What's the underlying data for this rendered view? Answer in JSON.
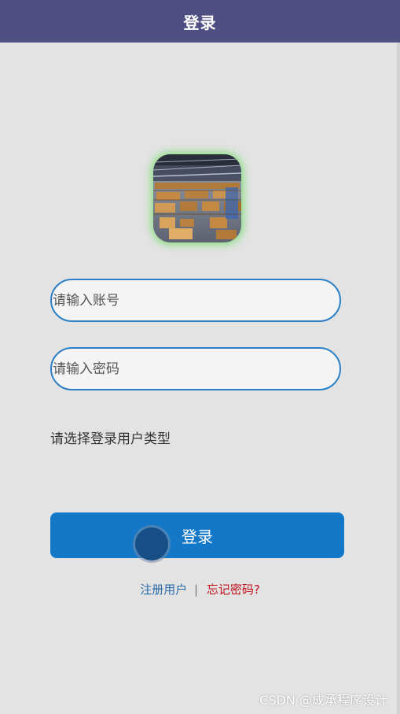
{
  "header": {
    "title": "登录"
  },
  "logo": {
    "description_icon": "warehouse-photo"
  },
  "form": {
    "account_placeholder": "请输入账号",
    "password_placeholder": "请输入密码",
    "user_type_label": "请选择登录用户类型",
    "login_button_label": "登录"
  },
  "links": {
    "register_label": "注册用户",
    "separator": "|",
    "forgot_label": "忘记密码?"
  },
  "watermark": {
    "text": "CSDN @成承程序设计"
  },
  "colors": {
    "navbar": "#4f4f84",
    "background": "#e3e3e3",
    "input_border": "#2b7fc6",
    "button": "#1478c8",
    "forgot_link": "#c0101a",
    "register_link": "#2b6aa8"
  }
}
